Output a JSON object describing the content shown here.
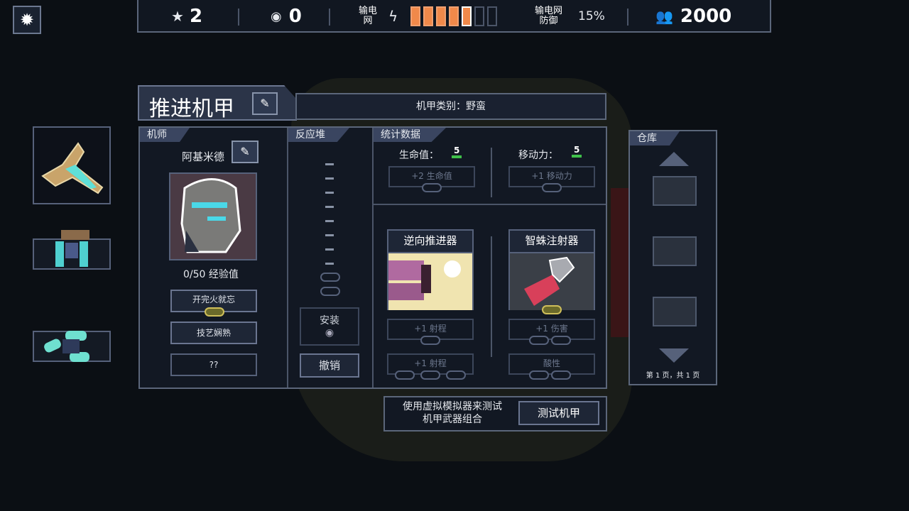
{
  "top_bar": {
    "stars": "2",
    "cores": "0",
    "grid_power_label": "输电\n网",
    "grid_power_bars": [
      1,
      1,
      1,
      1,
      1,
      0,
      0
    ],
    "grid_defense_label": "输电网\n防御",
    "grid_defense_value": "15%",
    "population": "2000"
  },
  "mech": {
    "name": "推进机甲",
    "class_text": "机甲类别：野蛮"
  },
  "pilot": {
    "section": "机师",
    "name": "阿基米德",
    "xp": "0/50 经验值",
    "skills": [
      "开完火就忘",
      "技艺娴熟",
      "??"
    ]
  },
  "reactor": {
    "section": "反应堆",
    "install": "安装",
    "undo": "撤销"
  },
  "stats": {
    "section": "统计数据",
    "health_label": "生命值：",
    "health_value": "5",
    "move_label": "移动力：",
    "move_value": "5",
    "health_upgrade": "+2 生命值",
    "move_upgrade": "+1 移动力"
  },
  "weapons": [
    {
      "name": "逆向推进器",
      "upgrades": [
        "+1 射程",
        "+1 射程"
      ]
    },
    {
      "name": "智蛛注射器",
      "upgrades": [
        "+1 伤害",
        "酸性"
      ]
    }
  ],
  "storage": {
    "section": "仓库",
    "page": "第 1 页，共 1 页"
  },
  "simulator": {
    "text": "使用虚拟模拟器来测试\n机甲武器组合",
    "button": "测试机甲"
  },
  "colors": {
    "accent_orange": "#f0894a",
    "panel": "#121823",
    "border": "#5b667a"
  }
}
